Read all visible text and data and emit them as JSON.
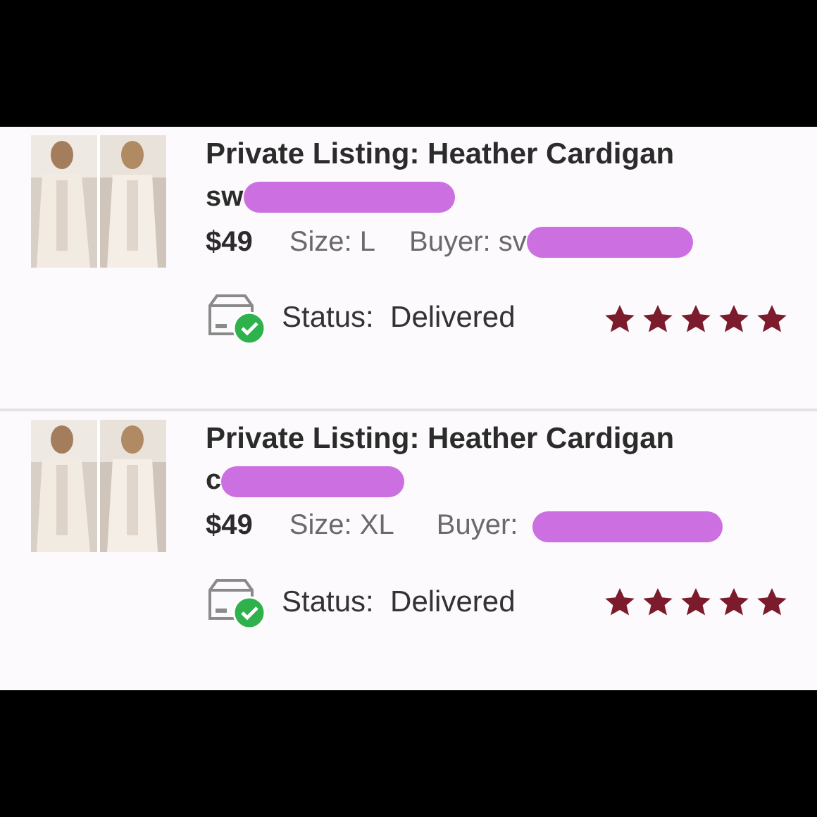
{
  "orders": [
    {
      "title": "Private Listing: Heather Cardigan",
      "seller": "sw",
      "price": "$49",
      "size": "Size: L",
      "buyer": "Buyer: sv",
      "status": "Status:  Delivered",
      "stars": 5
    },
    {
      "title": "Private Listing: Heather Cardigan",
      "seller": "c",
      "price": "$49",
      "size": "Size: XL",
      "buyer": "Buyer:",
      "status": "Status:  Delivered",
      "stars": 5
    }
  ]
}
